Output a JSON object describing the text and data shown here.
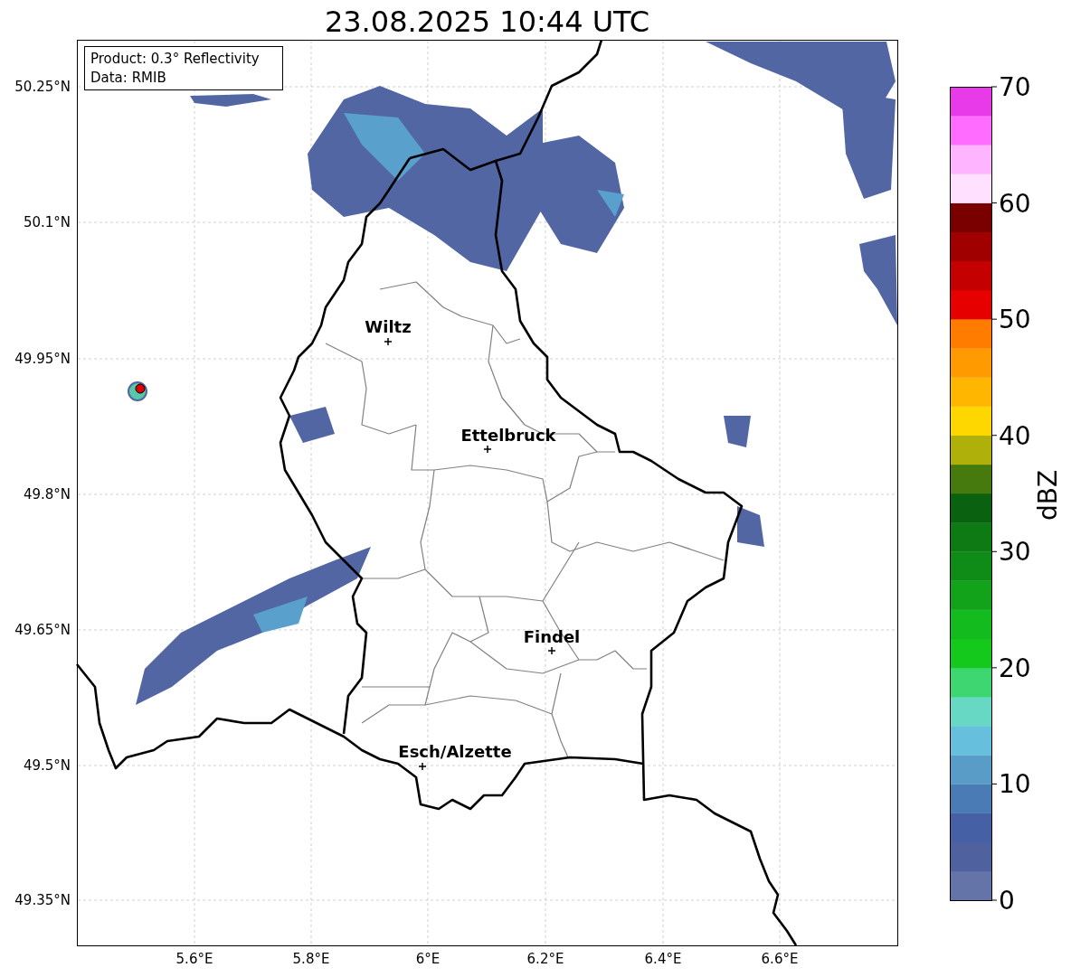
{
  "title": "23.08.2025 10:44 UTC",
  "info_box": [
    "Product: 0.3° Reflectivity",
    "Data: RMIB"
  ],
  "map": {
    "lat_ticks": [
      "50.25°N",
      "50.1°N",
      "49.95°N",
      "49.8°N",
      "49.65°N",
      "49.5°N",
      "49.35°N"
    ],
    "lon_ticks": [
      "5.6°E",
      "5.8°E",
      "6°E",
      "6.2°E",
      "6.4°E",
      "6.6°E"
    ],
    "cities": [
      {
        "name": "Wiltz"
      },
      {
        "name": "Ettelbruck"
      },
      {
        "name": "Findel"
      },
      {
        "name": "Esch/Alzette"
      }
    ]
  },
  "colorbar": {
    "label": "dBZ",
    "ticks": [
      "70",
      "60",
      "50",
      "40",
      "30",
      "20",
      "10",
      "0"
    ],
    "bands": [
      {
        "color": "#6474a8"
      },
      {
        "color": "#5061a0"
      },
      {
        "color": "#4560a5"
      },
      {
        "color": "#4a7bb5"
      },
      {
        "color": "#5a9cc8"
      },
      {
        "color": "#66bfdc"
      },
      {
        "color": "#66d8c4"
      },
      {
        "color": "#3dd670"
      },
      {
        "color": "#14c81c"
      },
      {
        "color": "#14bb1e"
      },
      {
        "color": "#12a31a"
      },
      {
        "color": "#0f8c17"
      },
      {
        "color": "#0d7a14"
      },
      {
        "color": "#0a6211"
      },
      {
        "color": "#467a0e"
      },
      {
        "color": "#b0b00a"
      },
      {
        "color": "#ffd700"
      },
      {
        "color": "#ffb600"
      },
      {
        "color": "#ff9a00"
      },
      {
        "color": "#ff7c00"
      },
      {
        "color": "#e60000"
      },
      {
        "color": "#c40000"
      },
      {
        "color": "#a00000"
      },
      {
        "color": "#7a0000"
      },
      {
        "color": "#ffe0ff"
      },
      {
        "color": "#ffb4ff"
      },
      {
        "color": "#ff6cff"
      },
      {
        "color": "#e93ae9"
      }
    ]
  }
}
